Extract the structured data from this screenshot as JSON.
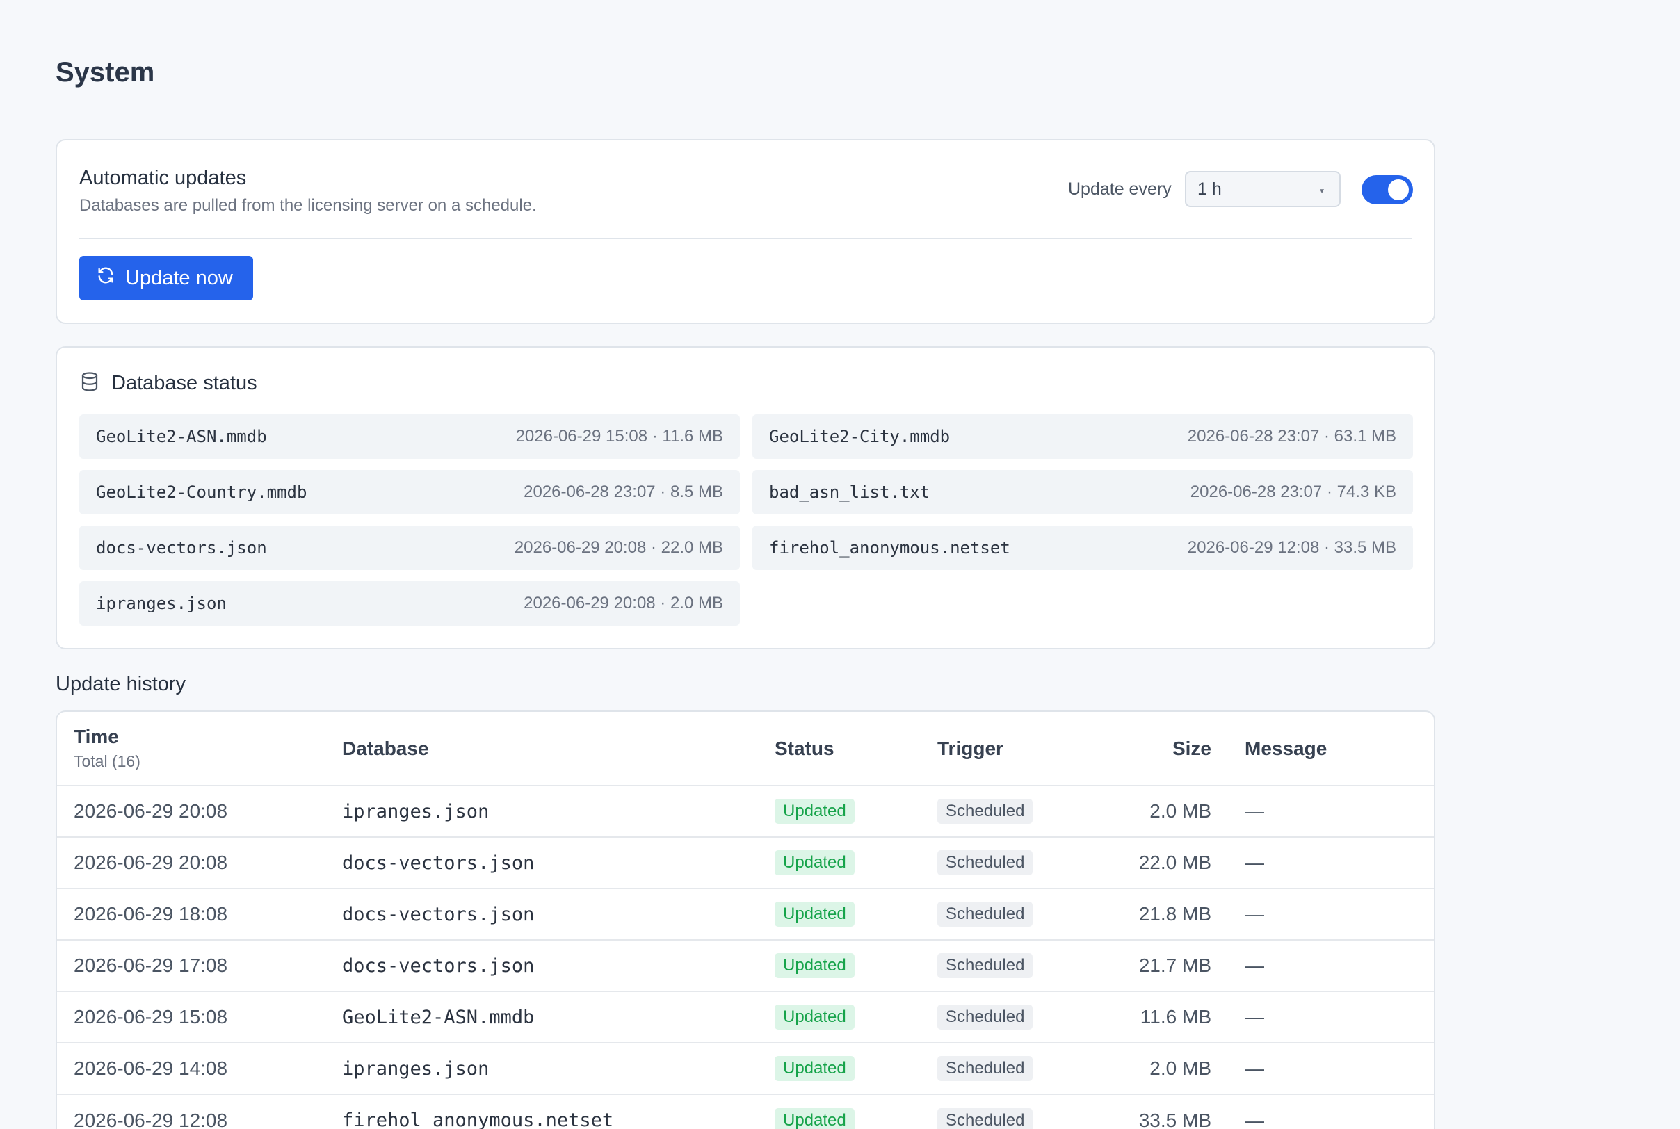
{
  "page": {
    "title": "System"
  },
  "auto_updates": {
    "title": "Automatic updates",
    "subtitle": "Databases are pulled from the licensing server on a schedule.",
    "interval_label": "Update every",
    "interval_value": "1 h",
    "enabled": true,
    "update_now_label": "Update now"
  },
  "database_status": {
    "title": "Database status",
    "items": [
      {
        "name": "GeoLite2-ASN.mmdb",
        "meta": "2026-06-29 15:08 · 11.6 MB"
      },
      {
        "name": "GeoLite2-City.mmdb",
        "meta": "2026-06-28 23:07 · 63.1 MB"
      },
      {
        "name": "GeoLite2-Country.mmdb",
        "meta": "2026-06-28 23:07 · 8.5 MB"
      },
      {
        "name": "bad_asn_list.txt",
        "meta": "2026-06-28 23:07 · 74.3 KB"
      },
      {
        "name": "docs-vectors.json",
        "meta": "2026-06-29 20:08 · 22.0 MB"
      },
      {
        "name": "firehol_anonymous.netset",
        "meta": "2026-06-29 12:08 · 33.5 MB"
      },
      {
        "name": "ipranges.json",
        "meta": "2026-06-29 20:08 · 2.0 MB"
      }
    ]
  },
  "history": {
    "title": "Update history",
    "columns": {
      "time": "Time",
      "total": "Total (16)",
      "database": "Database",
      "status": "Status",
      "trigger": "Trigger",
      "size": "Size",
      "message": "Message"
    },
    "rows": [
      {
        "time": "2026-06-29 20:08",
        "database": "ipranges.json",
        "status": "Updated",
        "trigger": "Scheduled",
        "size": "2.0 MB",
        "message": "—"
      },
      {
        "time": "2026-06-29 20:08",
        "database": "docs-vectors.json",
        "status": "Updated",
        "trigger": "Scheduled",
        "size": "22.0 MB",
        "message": "—"
      },
      {
        "time": "2026-06-29 18:08",
        "database": "docs-vectors.json",
        "status": "Updated",
        "trigger": "Scheduled",
        "size": "21.8 MB",
        "message": "—"
      },
      {
        "time": "2026-06-29 17:08",
        "database": "docs-vectors.json",
        "status": "Updated",
        "trigger": "Scheduled",
        "size": "21.7 MB",
        "message": "—"
      },
      {
        "time": "2026-06-29 15:08",
        "database": "GeoLite2-ASN.mmdb",
        "status": "Updated",
        "trigger": "Scheduled",
        "size": "11.6 MB",
        "message": "—"
      },
      {
        "time": "2026-06-29 14:08",
        "database": "ipranges.json",
        "status": "Updated",
        "trigger": "Scheduled",
        "size": "2.0 MB",
        "message": "—"
      },
      {
        "time": "2026-06-29 12:08",
        "database": "firehol_anonymous.netset",
        "status": "Updated",
        "trigger": "Scheduled",
        "size": "33.5 MB",
        "message": "—"
      }
    ]
  },
  "colors": {
    "accent": "#2563eb",
    "success": "#16a34a"
  }
}
